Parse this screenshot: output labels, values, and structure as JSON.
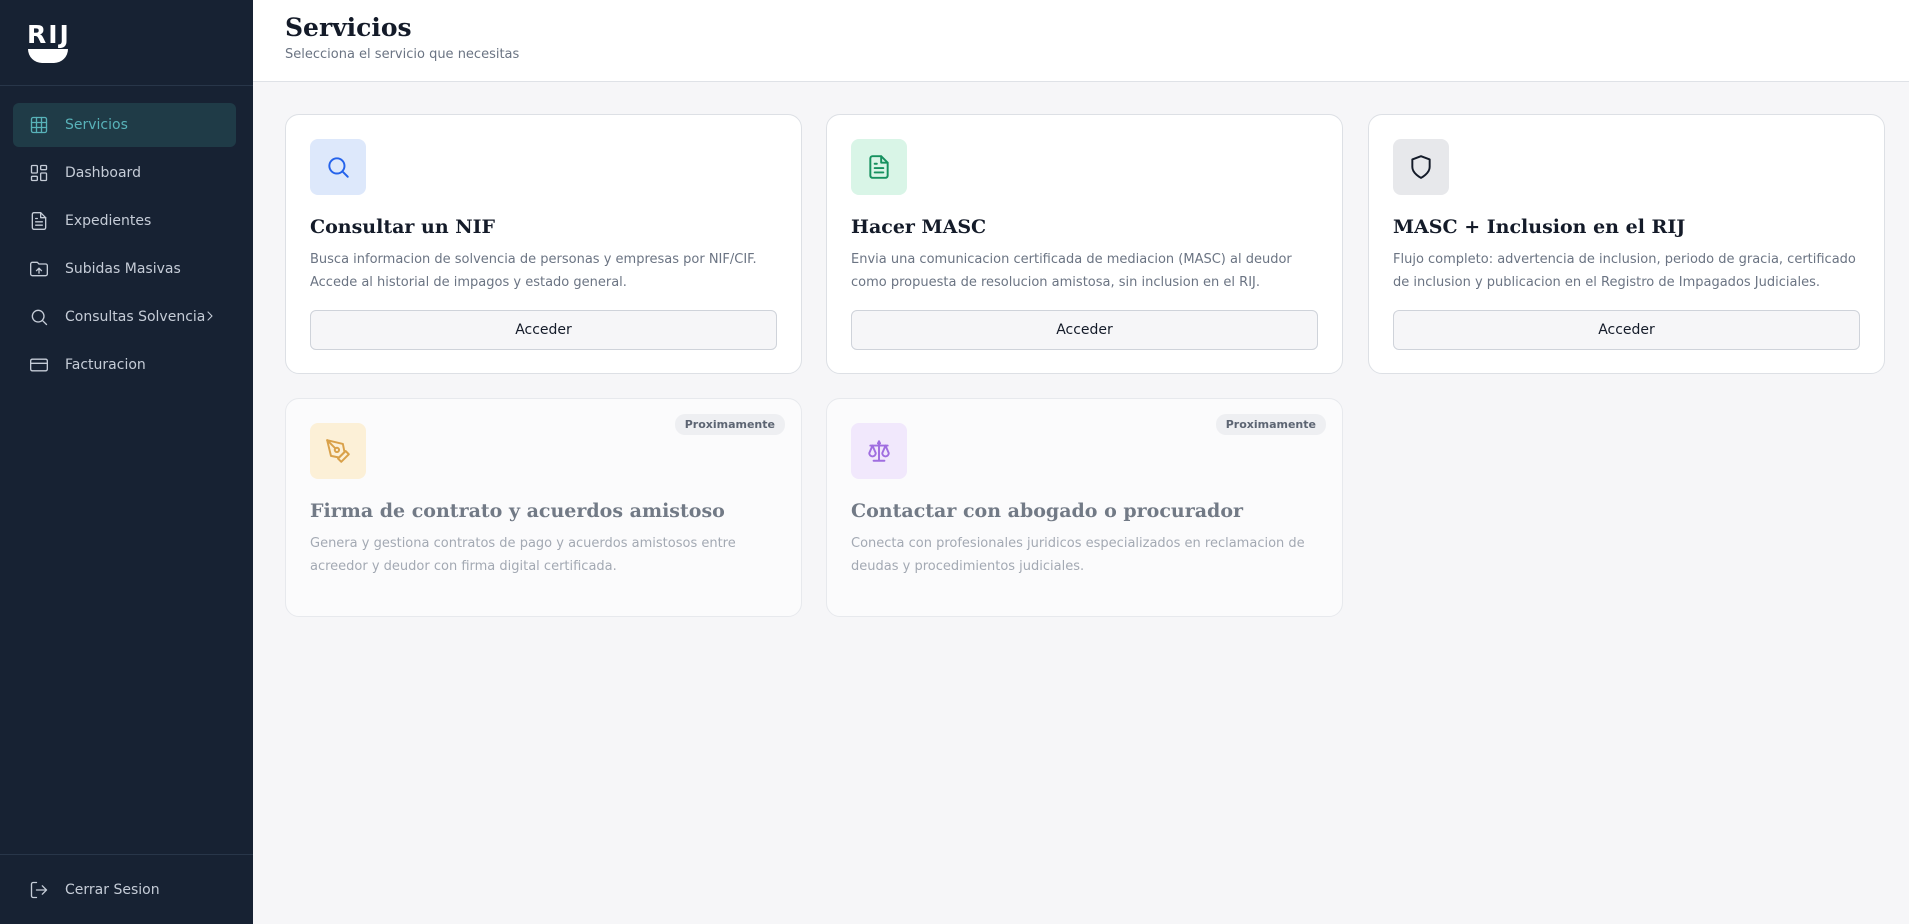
{
  "app": {
    "logo_text": "RIJ"
  },
  "sidebar": {
    "items": [
      {
        "label": "Servicios",
        "icon": "grid-icon",
        "active": true
      },
      {
        "label": "Dashboard",
        "icon": "dashboard-icon"
      },
      {
        "label": "Expedientes",
        "icon": "document-icon"
      },
      {
        "label": "Subidas Masivas",
        "icon": "folder-upload-icon"
      },
      {
        "label": "Consultas Solvencia",
        "icon": "search-icon",
        "has_submenu": true
      },
      {
        "label": "Facturacion",
        "icon": "credit-card-icon"
      }
    ],
    "logout_label": "Cerrar Sesion"
  },
  "header": {
    "title": "Servicios",
    "subtitle": "Selecciona el servicio que necesitas"
  },
  "cards": [
    {
      "title": "Consultar un NIF",
      "description": "Busca informacion de solvencia de personas y empresas por NIF/CIF. Accede al historial de impagos y estado general.",
      "button": "Acceder",
      "icon": "search-icon",
      "color": "#2563eb",
      "bg": "#dde8fb"
    },
    {
      "title": "Hacer MASC",
      "description": "Envia una comunicacion certificada de mediacion (MASC) al deudor como propuesta de resolucion amistosa, sin inclusion en el RIJ.",
      "button": "Acceder",
      "icon": "document-icon",
      "color": "#16915f",
      "bg": "#d9f5e7"
    },
    {
      "title": "MASC + Inclusion en el RIJ",
      "description": "Flujo completo: advertencia de inclusion, periodo de gracia, certificado de inclusion y publicacion en el Registro de Impagados Judiciales.",
      "button": "Acceder",
      "icon": "shield-icon",
      "color": "#141b29",
      "bg": "#e7e8eb"
    },
    {
      "title": "Firma de contrato y acuerdos amistoso",
      "description": "Genera y gestiona contratos de pago y acuerdos amistosos entre acreedor y deudor con firma digital certificada.",
      "badge": "Proximamente",
      "icon": "pen-tool-icon",
      "color": "#d9a14a",
      "bg": "#fcf0d7"
    },
    {
      "title": "Contactar con abogado o procurador",
      "description": "Conecta con profesionales juridicos especializados en reclamacion de deudas y procedimientos judiciales.",
      "badge": "Proximamente",
      "icon": "scale-icon",
      "color": "#a06ee0",
      "bg": "#f1e8fc"
    }
  ]
}
